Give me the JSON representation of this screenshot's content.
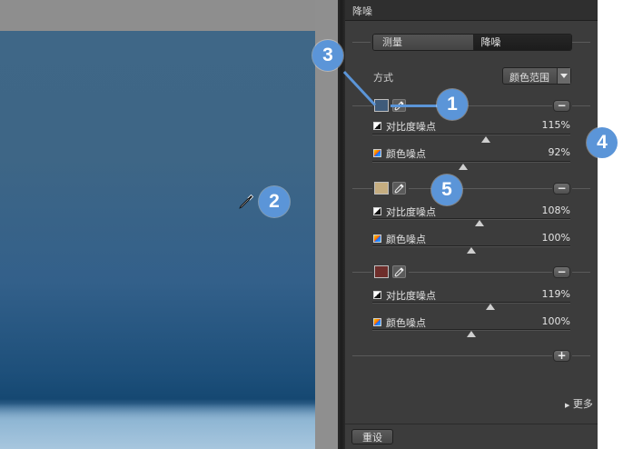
{
  "panel": {
    "title": "降噪",
    "mode_tabs": [
      "测量",
      "降噪"
    ],
    "method_label": "方式",
    "method_value": "颜色范围",
    "ranges": [
      {
        "swatch_color": "#3f5b7a",
        "contrast_label": "对比度噪点",
        "contrast_value": "115%",
        "contrast_level_percent": 115,
        "color_label": "颜色噪点",
        "color_value": "92%",
        "color_level_percent": 92
      },
      {
        "swatch_color": "#c5ad80",
        "contrast_label": "对比度噪点",
        "contrast_value": "108%",
        "contrast_level_percent": 108,
        "color_label": "颜色噪点",
        "color_value": "100%",
        "color_level_percent": 100
      },
      {
        "swatch_color": "#6e2e2b",
        "contrast_label": "对比度噪点",
        "contrast_value": "119%",
        "contrast_level_percent": 119,
        "color_label": "颜色噪点",
        "color_value": "100%",
        "color_level_percent": 100
      }
    ],
    "more_label": "更多",
    "reset_label": "重设"
  },
  "callouts": [
    "1",
    "2",
    "3",
    "4",
    "5"
  ],
  "colors": {
    "panel_bg": "#3c3c3c",
    "accent": "#5b95d8",
    "photo_sky": "#3f6787",
    "photo_deep": "#154872"
  },
  "icons": [
    "eyedropper-icon",
    "minus-icon",
    "plus-icon",
    "contrast-icon",
    "color-noise-icon",
    "disclosure-triangle-icon",
    "chevron-down-icon"
  ]
}
